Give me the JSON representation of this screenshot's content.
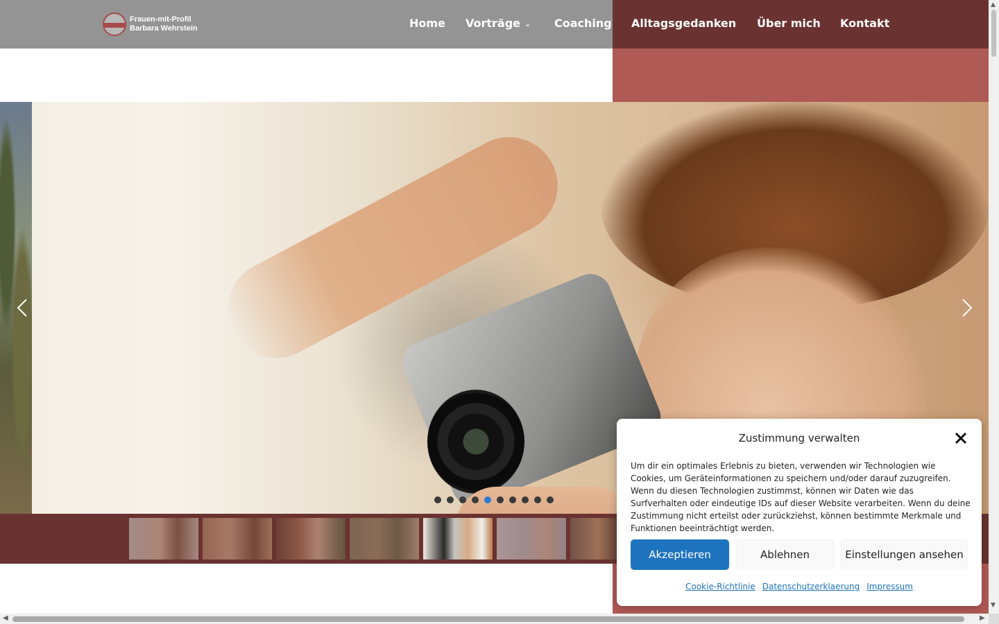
{
  "header": {
    "logo_line1": "Frauen-mit-Profil",
    "logo_line2": "Barbara Wehrstein",
    "nav": [
      {
        "label": "Home"
      },
      {
        "label": "Vorträge",
        "has_dropdown": true
      },
      {
        "label": "Coaching"
      },
      {
        "label": "Alltagsgedanken"
      },
      {
        "label": "Über mich"
      },
      {
        "label": "Kontakt"
      }
    ]
  },
  "slider": {
    "slide_count": 10,
    "active_index": 4,
    "prev_icon": "chevron-left-icon",
    "next_icon": "chevron-right-icon",
    "thumbnail_count": 7
  },
  "consent": {
    "title": "Zustimmung verwalten",
    "body": "Um dir ein optimales Erlebnis zu bieten, verwenden wir Technologien wie Cookies, um Geräteinformationen zu speichern und/oder darauf zuzugreifen. Wenn du diesen Technologien zustimmst, können wir Daten wie das Surfverhalten oder eindeutige IDs auf dieser Website verarbeiten. Wenn du deine Zustimmung nicht erteilst oder zurückziehst, können bestimmte Merkmale und Funktionen beeinträchtigt werden.",
    "accept_label": "Akzeptieren",
    "deny_label": "Ablehnen",
    "settings_label": "Einstellungen ansehen",
    "links": [
      "Cookie-Richtlinie",
      "Datenschutzerklaerung",
      "Impressum"
    ]
  },
  "colors": {
    "header_gray": "#949494",
    "maroon_dark": "#6a3230",
    "maroon_light": "#b05a55",
    "accent_blue": "#1e73be",
    "active_dot": "#2e7ad1"
  }
}
